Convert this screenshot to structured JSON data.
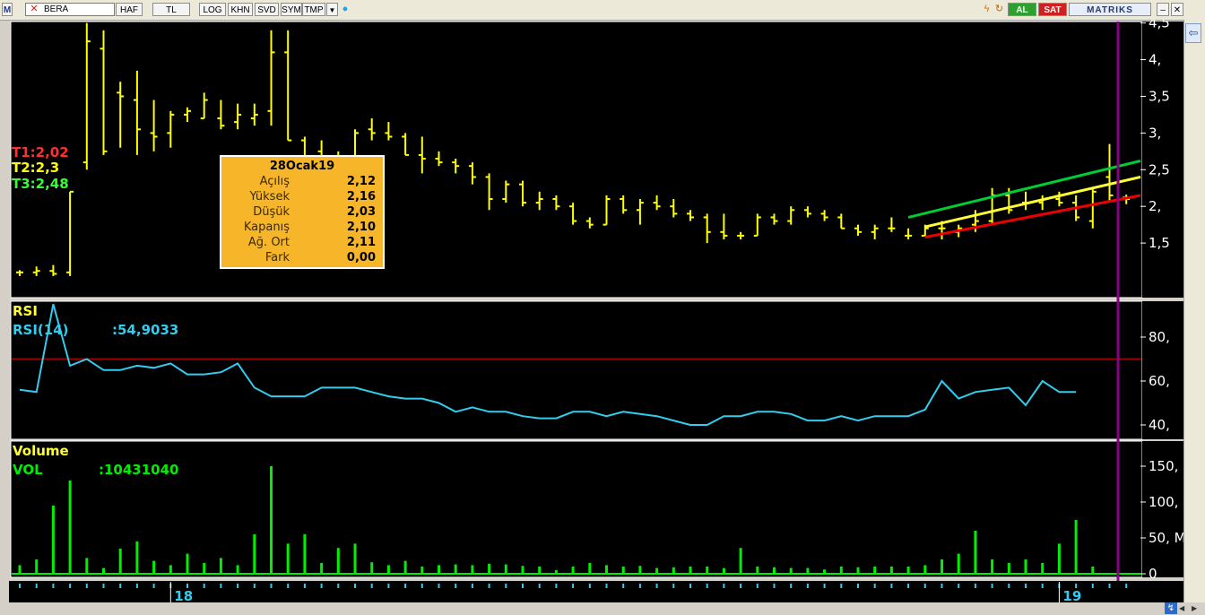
{
  "toolbar": {
    "symbol": "BERA",
    "buttons": [
      "HAF",
      "TL",
      "LOG",
      "KHN",
      "SVD",
      "SYM",
      "TMP"
    ],
    "buy_label": "AL",
    "sell_label": "SAT",
    "brand": "MATRIKS"
  },
  "colors": {
    "background": "#000000",
    "price_bars": "#ffff00",
    "rsi_line": "#33ccee",
    "rsi_level": "#990000",
    "volume_bars": "#00ee00",
    "upper_channel": "#00cc33",
    "middle_channel": "#ffff33",
    "lower_channel": "#ee0000",
    "cursor_line": "#880088",
    "t1": "#ff3030",
    "t2": "#ffff00",
    "t3": "#33ff33"
  },
  "legend": {
    "t1": "T1:2,02",
    "t2": "T2:2,3",
    "t3": "T3:2,48",
    "rsi_title": "RSI",
    "rsi_label": "RSI(14)",
    "rsi_value": ":54,9033",
    "vol_title": "Volume",
    "vol_label": "VOL",
    "vol_value": ":10431040"
  },
  "infobox": {
    "title": "28Ocak19",
    "rows": [
      {
        "label": "Açılış",
        "value": "2,12"
      },
      {
        "label": "Yüksek",
        "value": "2,16"
      },
      {
        "label": "Düşük",
        "value": "2,03"
      },
      {
        "label": "Kapanış",
        "value": "2,10"
      },
      {
        "label": "Ağ. Ort",
        "value": "2,11"
      },
      {
        "label": "Fark",
        "value": "0,00"
      }
    ]
  },
  "chart_data": {
    "type": "ohlc",
    "price_axis_ticks": [
      {
        "v": 4.5,
        "label": "4,5"
      },
      {
        "v": 4.0,
        "label": "4,"
      },
      {
        "v": 3.5,
        "label": "3,5"
      },
      {
        "v": 3.0,
        "label": "3,"
      },
      {
        "v": 2.5,
        "label": "2,5"
      },
      {
        "v": 2.0,
        "label": "2,"
      },
      {
        "v": 1.5,
        "label": "1,5"
      }
    ],
    "rsi_axis_ticks": [
      {
        "v": 80,
        "label": "80,"
      },
      {
        "v": 60,
        "label": "60,"
      },
      {
        "v": 40,
        "label": "40,"
      }
    ],
    "volume_axis_ticks": [
      {
        "v": 150,
        "label": "150, M"
      },
      {
        "v": 100,
        "label": "100, M"
      },
      {
        "v": 50,
        "label": "50, M"
      },
      {
        "v": 0,
        "label": "0"
      }
    ],
    "x_labels": [
      {
        "index": 9,
        "label": "18"
      },
      {
        "index": 62,
        "label": "19"
      }
    ],
    "rsi_level": 70,
    "ohlc": [
      [
        1.1,
        1.13,
        1.05,
        1.1
      ],
      [
        1.1,
        1.18,
        1.05,
        1.12
      ],
      [
        1.12,
        1.2,
        1.05,
        1.08
      ],
      [
        1.1,
        2.2,
        1.05,
        2.2
      ],
      [
        2.6,
        4.5,
        2.5,
        4.25
      ],
      [
        4.15,
        4.4,
        2.7,
        2.75
      ],
      [
        3.55,
        3.7,
        2.8,
        3.5
      ],
      [
        3.45,
        3.85,
        2.7,
        3.05
      ],
      [
        3.0,
        3.45,
        2.75,
        2.95
      ],
      [
        3.0,
        3.3,
        2.8,
        3.25
      ],
      [
        3.25,
        3.35,
        3.15,
        3.3
      ],
      [
        3.2,
        3.55,
        3.2,
        3.45
      ],
      [
        3.2,
        3.45,
        3.05,
        3.1
      ],
      [
        3.15,
        3.4,
        3.05,
        3.25
      ],
      [
        3.2,
        3.4,
        3.1,
        3.25
      ],
      [
        3.3,
        4.4,
        3.1,
        4.1
      ],
      [
        4.1,
        4.4,
        2.9,
        2.9
      ],
      [
        2.9,
        2.95,
        2.35,
        2.35
      ],
      [
        2.75,
        2.9,
        2.3,
        2.55
      ],
      [
        2.55,
        2.75,
        2.45,
        2.6
      ],
      [
        2.65,
        3.05,
        2.55,
        3.0
      ],
      [
        3.05,
        3.2,
        2.9,
        3.0
      ],
      [
        3.0,
        3.15,
        2.9,
        2.95
      ],
      [
        2.95,
        3.0,
        2.7,
        2.7
      ],
      [
        2.7,
        2.95,
        2.45,
        2.65
      ],
      [
        2.65,
        2.75,
        2.55,
        2.6
      ],
      [
        2.6,
        2.65,
        2.45,
        2.55
      ],
      [
        2.55,
        2.6,
        2.3,
        2.4
      ],
      [
        2.4,
        2.45,
        1.95,
        2.1
      ],
      [
        2.1,
        2.35,
        2.05,
        2.3
      ],
      [
        2.3,
        2.35,
        2.0,
        2.05
      ],
      [
        2.05,
        2.2,
        1.95,
        2.1
      ],
      [
        2.1,
        2.15,
        1.95,
        2.0
      ],
      [
        2.0,
        2.05,
        1.75,
        1.8
      ],
      [
        1.8,
        1.85,
        1.7,
        1.75
      ],
      [
        1.75,
        2.15,
        1.75,
        2.1
      ],
      [
        2.1,
        2.15,
        1.9,
        1.95
      ],
      [
        1.95,
        2.1,
        1.75,
        2.05
      ],
      [
        2.05,
        2.15,
        1.95,
        2.0
      ],
      [
        2.0,
        2.1,
        1.85,
        1.9
      ],
      [
        1.9,
        1.95,
        1.8,
        1.85
      ],
      [
        1.85,
        1.9,
        1.5,
        1.65
      ],
      [
        1.65,
        1.9,
        1.55,
        1.6
      ],
      [
        1.6,
        1.65,
        1.55,
        1.6
      ],
      [
        1.6,
        1.9,
        1.6,
        1.85
      ],
      [
        1.85,
        1.9,
        1.75,
        1.8
      ],
      [
        1.8,
        2.0,
        1.75,
        1.95
      ],
      [
        1.95,
        2.0,
        1.85,
        1.9
      ],
      [
        1.9,
        1.95,
        1.8,
        1.85
      ],
      [
        1.85,
        1.9,
        1.7,
        1.7
      ],
      [
        1.7,
        1.75,
        1.6,
        1.65
      ],
      [
        1.65,
        1.75,
        1.55,
        1.7
      ],
      [
        1.7,
        1.85,
        1.65,
        1.7
      ],
      [
        1.6,
        1.7,
        1.55,
        1.6
      ],
      [
        1.6,
        1.75,
        1.6,
        1.7
      ],
      [
        1.7,
        1.8,
        1.55,
        1.7
      ],
      [
        1.65,
        1.75,
        1.58,
        1.7
      ],
      [
        1.75,
        1.95,
        1.65,
        1.8
      ],
      [
        1.8,
        2.25,
        1.75,
        2.15
      ],
      [
        2.15,
        2.25,
        1.9,
        1.95
      ],
      [
        2.05,
        2.2,
        1.95,
        2.05
      ],
      [
        2.05,
        2.15,
        1.95,
        2.1
      ],
      [
        2.1,
        2.2,
        2.0,
        2.05
      ],
      [
        2.05,
        2.15,
        1.8,
        1.85
      ],
      [
        1.8,
        2.25,
        1.7,
        2.2
      ],
      [
        2.4,
        2.85,
        2.05,
        2.15
      ],
      [
        2.12,
        2.16,
        2.03,
        2.1
      ]
    ],
    "rsi": [
      56,
      55,
      95,
      67,
      70,
      65,
      65,
      67,
      66,
      68,
      63,
      63,
      64,
      68,
      57,
      53,
      53,
      53,
      57,
      57,
      57,
      55,
      53,
      52,
      52,
      50,
      46,
      48,
      46,
      46,
      44,
      43,
      43,
      46,
      46,
      44,
      46,
      45,
      44,
      42,
      40,
      40,
      44,
      44,
      46,
      46,
      45,
      42,
      42,
      44,
      42,
      44,
      44,
      44,
      47,
      60,
      52,
      55,
      56,
      57,
      49,
      60,
      55,
      55
    ],
    "volume": [
      12,
      20,
      95,
      130,
      22,
      8,
      35,
      45,
      18,
      12,
      28,
      15,
      22,
      12,
      55,
      150,
      42,
      55,
      15,
      36,
      42,
      16,
      12,
      18,
      10,
      12,
      13,
      12,
      14,
      13,
      11,
      10,
      5,
      10,
      15,
      12,
      10,
      11,
      8,
      9,
      10,
      10,
      8,
      36,
      10,
      9,
      8,
      8,
      6,
      10,
      9,
      10,
      10,
      10,
      12,
      20,
      28,
      60,
      20,
      15,
      20,
      15,
      42,
      75,
      10
    ]
  }
}
